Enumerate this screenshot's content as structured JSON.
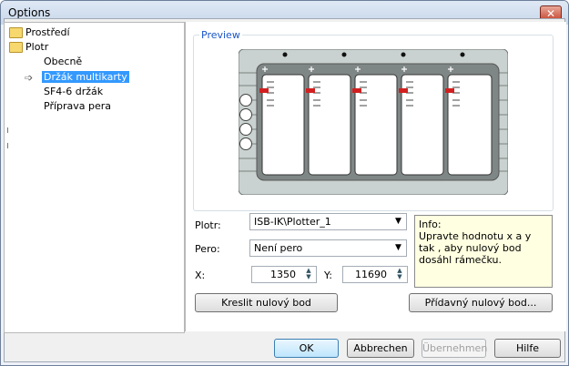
{
  "window": {
    "title": "Options",
    "close_glyph": "✕"
  },
  "tree": {
    "items": [
      {
        "label": "Prostředí",
        "icon": "folder-icon"
      },
      {
        "label": "Plotr",
        "icon": "folder-icon"
      },
      {
        "label": "Obecně"
      },
      {
        "label": "Držák multikarty",
        "selected": true
      },
      {
        "label": "SF4-6 držák"
      },
      {
        "label": "Příprava pera"
      }
    ]
  },
  "preview": {
    "group_label": "Preview"
  },
  "form": {
    "plotr_label": "Plotr:",
    "plotr_value": "ISB-IK\\Plotter_1",
    "pero_label": "Pero:",
    "pero_value": "Není pero",
    "x_label": "X:",
    "x_value": "1350",
    "y_label": "Y:",
    "y_value": "11690",
    "kreslit_button": "Kreslit nulový bod",
    "pridavny_button": "Přídavný nulový bod..."
  },
  "info": {
    "heading": "Info:",
    "text": "Upravte hodnotu x a y tak , aby nulový bod dosáhl rámečku."
  },
  "footer": {
    "ok": "OK",
    "cancel": "Abbrechen",
    "apply": "Übernehmen",
    "help": "Hilfe"
  },
  "colors": {
    "selection": "#3399ff",
    "accent_label": "#1a55c8",
    "marker": "#d22020"
  }
}
